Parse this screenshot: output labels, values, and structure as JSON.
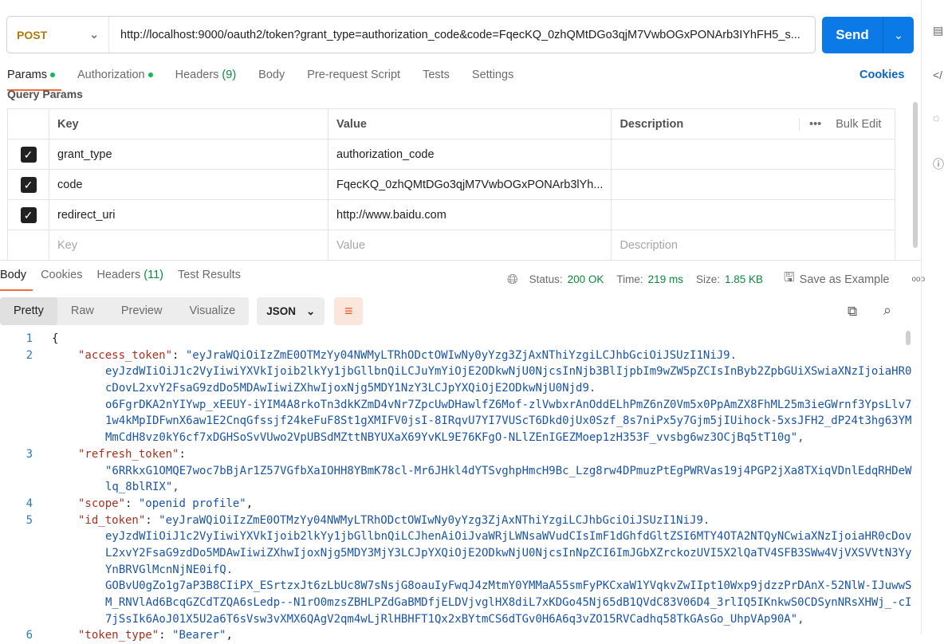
{
  "request": {
    "method": "POST",
    "url": "http://localhost:9000/oauth2/token?grant_type=authorization_code&code=FqecKQ_0zhQMtDGo3qjM7VwbOGxPONArb3IYhFH5_s...",
    "send_label": "Send"
  },
  "request_tabs": [
    {
      "label": "Params",
      "dot": true
    },
    {
      "label": "Authorization",
      "dot": true
    },
    {
      "label": "Headers",
      "count": "(9)"
    },
    {
      "label": "Body"
    },
    {
      "label": "Pre-request Script"
    },
    {
      "label": "Tests"
    },
    {
      "label": "Settings"
    }
  ],
  "cookies_label": "Cookies",
  "query_params": {
    "title": "Query Params",
    "headers": [
      "Key",
      "Value",
      "Description"
    ],
    "bulk_edit": "Bulk Edit",
    "rows": [
      {
        "key": "grant_type",
        "value": "authorization_code",
        "checked": true
      },
      {
        "key": "code",
        "value": "FqecKQ_0zhQMtDGo3qjM7VwbOGxPONArb3lYh...",
        "checked": true
      },
      {
        "key": "redirect_uri",
        "value": "http://www.baidu.com",
        "checked": true
      }
    ],
    "placeholder": {
      "key": "Key",
      "value": "Value",
      "description": "Description"
    }
  },
  "response_tabs": [
    {
      "label": "Body"
    },
    {
      "label": "Cookies"
    },
    {
      "label": "Headers",
      "count": "(11)"
    },
    {
      "label": "Test Results"
    }
  ],
  "status": {
    "status_label": "Status:",
    "status": "200 OK",
    "time_label": "Time:",
    "time": "219 ms",
    "size_label": "Size:",
    "size": "1.85 KB",
    "save": "Save as Example"
  },
  "format_tabs": [
    "Pretty",
    "Raw",
    "Preview",
    "Visualize"
  ],
  "format_select": "JSON",
  "code_lines": [
    {
      "n": "1",
      "parts": [
        [
          "{",
          ""
        ]
      ]
    },
    {
      "n": "2",
      "parts": [
        [
          "\"access_token\"",
          "k"
        ],
        [
          ": ",
          ""
        ],
        [
          "\"eyJraWQiOiIzZmE0OTMzYy04NWMyLTRhODctOWIwNy0yYzg3ZjAxNThiYzgiLCJhbGciOiJSUzI1NiJ9.",
          "s"
        ]
      ]
    },
    {
      "c": "eyJzdWIiOiJ1c2VyIiwiYXVkIjoib2lkYy1jbGllbnQiLCJuYmYiOjE2ODkwNjU0NjcsInNjb3BlIjpbIm9wZW5pZCIsInByb2ZpbGUiXSwiaXNzIjoiaHR0"
    },
    {
      "c": "cDovL2xvY2FsaG9zdDo5MDAwIiwiZXhwIjoxNjg5MDY1NzY3LCJpYXQiOjE2ODkwNjU0Njd9."
    },
    {
      "c": "o6FgrDKA2nYIYwp_xEEUY-iYIM4A8rkoTn3dkKZmD4vNr7ZpcUwDHawlfZ6Mof-zlVwbxrAnOddELhPmZ6nZ0Vm5x0PpAmZX8FhML25m3ieGWrnf3YpsLlv7"
    },
    {
      "c": "1w4kMpIDFwnX6aw1E2CnqGfssjf24keFuF8St1gXMIFV0jsI-8IRqvU7YI7VUScT6Dkd0jUx0Szf_8s7niPx5y7Gjm5jIUihock-5xsJFH2_dP24t3hg63YM"
    },
    {
      "c": "MmCdH8vz0kY6cf7xDGHSoSvVUwo2VpUBSdMZttNBYUXaX69YvKL9E76KFgO-NLlZEnIGEZMoep1zH353F_vvsbg6wz3OCjBq5tT10g\","
    },
    {
      "n": "3",
      "parts": [
        [
          "\"refresh_token\"",
          "k"
        ],
        [
          ":",
          ""
        ]
      ]
    },
    {
      "c": "\"6RRkxG1OMQE7woc7bBjAr1Z57VGfbXaIOHH8YBmK78cl-Mr6JHkl4dYTSvghpHmcH9Bc_Lzg8rw4DPmuzPtEgPWRVas19j4PGP2jXa8TXiqVDnlEdqRHDeW"
    },
    {
      "c": "lq_8blRIX\","
    },
    {
      "n": "4",
      "parts": [
        [
          "\"scope\"",
          "k"
        ],
        [
          ": ",
          ""
        ],
        [
          "\"openid profile\"",
          "s"
        ],
        [
          ",",
          ""
        ]
      ]
    },
    {
      "n": "5",
      "parts": [
        [
          "\"id_token\"",
          "k"
        ],
        [
          ": ",
          ""
        ],
        [
          "\"eyJraWQiOiIzZmE0OTMzYy04NWMyLTRhODctOWIwNy0yYzg3ZjAxNThiYzgiLCJhbGciOiJSUzI1NiJ9.",
          "s"
        ]
      ]
    },
    {
      "c": "eyJzdWIiOiJ1c2VyIiwiYXVkIjoib2lkYy1jbGllbnQiLCJhenAiOiJvaWRjLWNsaWVudCIsImF1dGhfdGltZSI6MTY4OTA2NTQyNCwiaXNzIjoiaHR0cDov"
    },
    {
      "c": "L2xvY2FsaG9zdDo5MDAwIiwiZXhwIjoxNjg5MDY3MjY3LCJpYXQiOjE2ODkwNjU0NjcsInNpZCI6ImJGbXZrckozUVI5X2lQaTV4SFB3SWw4VjVXSVVtN3Yy"
    },
    {
      "c": "YnBRVGlMcnNjNE0ifQ."
    },
    {
      "c": "GOBvU0gZo1g7aP3B8CIiPX_ESrtzxJt6zLbUc8W7sNsjG8oauIyFwqJ4zMtmY0YMMaA55smFyPKCxaW1YVqkvZwIIpt10Wxp9jdzzPrDAnX-52NlW-IJuwwS"
    },
    {
      "c": "M_RNVlAd6BcqGZCdTZQA6sLedp--N1rO0mzsZBHLPZdGaBMDfjELDVjvglHX8diL7xKDGo45Nj65dB1QVdC83V06D4_3rlIQ5IKnkwS0CDSynNRsXHWj_-cI"
    },
    {
      "c": "7jSsIk6AoJ01X5U2a6T6sVsw3vXMX6QAgV2qm4wLjRlHBHFT1Qx2xBYtmCS6dTGv0H6A6q3vZO15RVCadhq58TkGAsGo_UhpVAp90A\","
    },
    {
      "n": "6",
      "parts": [
        [
          "\"token_type\"",
          "k"
        ],
        [
          ": ",
          ""
        ],
        [
          "\"Bearer\"",
          "s"
        ],
        [
          ",",
          ""
        ]
      ]
    }
  ],
  "colors": {
    "accent": "#0c7ae6",
    "tab_underline": "#f26b3a",
    "ok": "#0a8a3c",
    "key": "#a5311f",
    "string": "#1a55a5"
  }
}
